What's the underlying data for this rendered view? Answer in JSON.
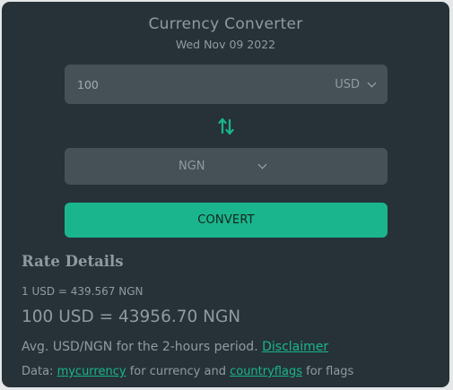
{
  "header": {
    "title": "Currency Converter",
    "date": "Wed Nov 09 2022"
  },
  "converter": {
    "amount_value": "100",
    "from_currency": "USD",
    "to_currency": "NGN",
    "convert_label": "CONVERT"
  },
  "icons": {
    "swap": "swap-vertical-arrows-icon",
    "dropdown": "chevron-down-icon"
  },
  "rate_details": {
    "heading": "Rate Details",
    "unit_rate": "1 USD = 439.567 NGN",
    "result": "100 USD = 43956.70 NGN",
    "avg_text": "Avg. USD/NGN for the 2-hours period.",
    "disclaimer_link": "Disclaimer",
    "data_prefix": "Data:",
    "currency_link": "mycurrency",
    "currency_suffix": "for currency and",
    "flags_link": "countryflags",
    "flags_suffix": "for flags"
  },
  "colors": {
    "card_background": "#263238",
    "field_background": "#455157",
    "accent": "#1ab58c",
    "text": "#8f9ba1"
  }
}
